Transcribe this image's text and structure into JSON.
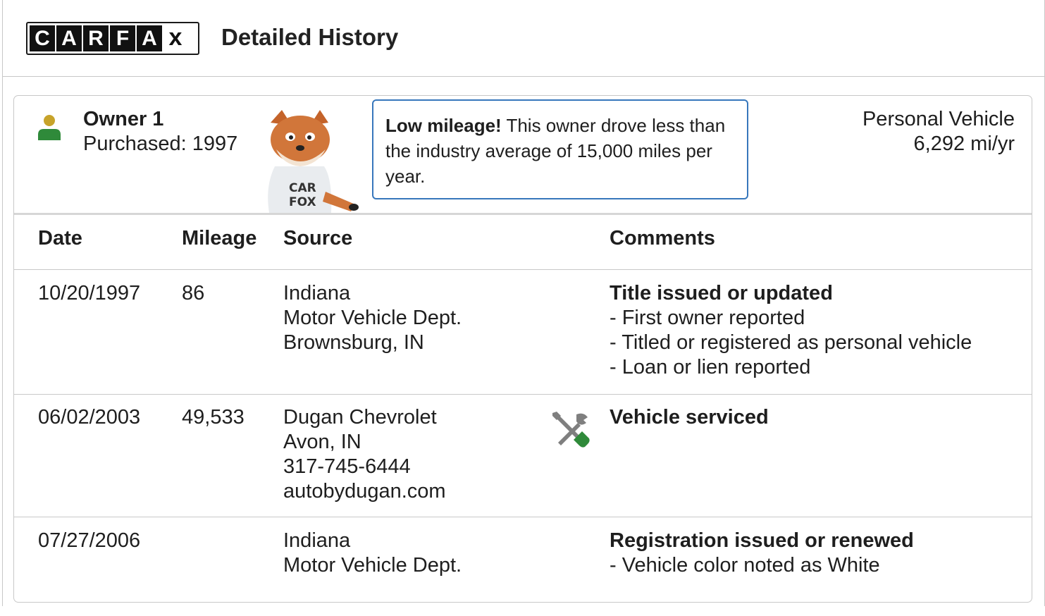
{
  "header": {
    "logo_letters": [
      "C",
      "A",
      "R",
      "F",
      "A",
      "X"
    ],
    "title": "Detailed History"
  },
  "owner": {
    "title": "Owner 1",
    "purchased": "Purchased: 1997",
    "callout_bold": "Low mileage!",
    "callout_rest": " This owner drove less than the industry average of 15,000 miles per year.",
    "vehicle_type": "Personal Vehicle",
    "mileage_rate": "6,292 mi/yr",
    "fox_shirt": "CAR FOX"
  },
  "table": {
    "headers": {
      "date": "Date",
      "mileage": "Mileage",
      "source": "Source",
      "comments": "Comments"
    },
    "rows": [
      {
        "date": "10/20/1997",
        "mileage": "86",
        "source": [
          "Indiana",
          "Motor Vehicle Dept.",
          "Brownsburg, IN"
        ],
        "comment_title": "Title issued or updated",
        "comment_items": [
          "First owner reported",
          "Titled or registered as personal vehicle",
          "Loan or lien reported"
        ]
      },
      {
        "date": "06/02/2003",
        "mileage": "49,533",
        "source": [
          "Dugan Chevrolet",
          "Avon, IN",
          "317-745-6444",
          "autobydugan.com"
        ],
        "icon": "service-wrench-icon",
        "comment_title": "Vehicle serviced",
        "comment_items": []
      },
      {
        "date": "07/27/2006",
        "mileage": "",
        "source": [
          "Indiana",
          "Motor Vehicle Dept."
        ],
        "comment_title": "Registration issued or renewed",
        "comment_items": [
          "Vehicle color noted as White"
        ]
      }
    ]
  },
  "colors": {
    "accent_blue": "#3777bc",
    "owner_icon_head": "#c7a32a",
    "owner_icon_body": "#2f8a3a",
    "service_green": "#2f8a3a"
  }
}
